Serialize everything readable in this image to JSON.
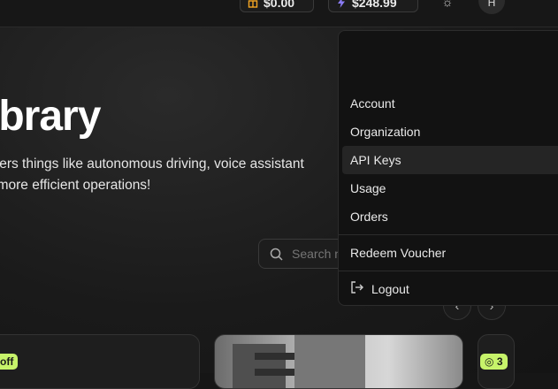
{
  "header": {
    "credit_pill": {
      "value": "$0.00",
      "icon": "gift-icon"
    },
    "balance_pill": {
      "value": "$248.99",
      "icon": "lightning-icon"
    },
    "theme_icon": "sun-icon",
    "avatar_initial": "H"
  },
  "hero": {
    "title": "ibrary",
    "description_line1": "wers things like autonomous driving, voice assistant",
    "description_line2": ", more efficient operations!"
  },
  "search": {
    "placeholder": "Search n",
    "icon": "search-icon"
  },
  "carousel": {
    "prev_icon": "chevron-left-icon",
    "next_icon": "chevron-right-icon",
    "cards": [
      {
        "badge": "off"
      },
      {
        "badge": ""
      },
      {
        "badge": "3"
      }
    ]
  },
  "menu": {
    "items": [
      "Account",
      "Organization",
      "API Keys",
      "Usage",
      "Orders"
    ],
    "active_item": "API Keys",
    "redeem": "Redeem Voucher",
    "logout": "Logout"
  },
  "colors": {
    "accent_badge": "#c7f36a",
    "credit_icon": "#f5a623",
    "balance_icon": "#8b7cf6"
  }
}
